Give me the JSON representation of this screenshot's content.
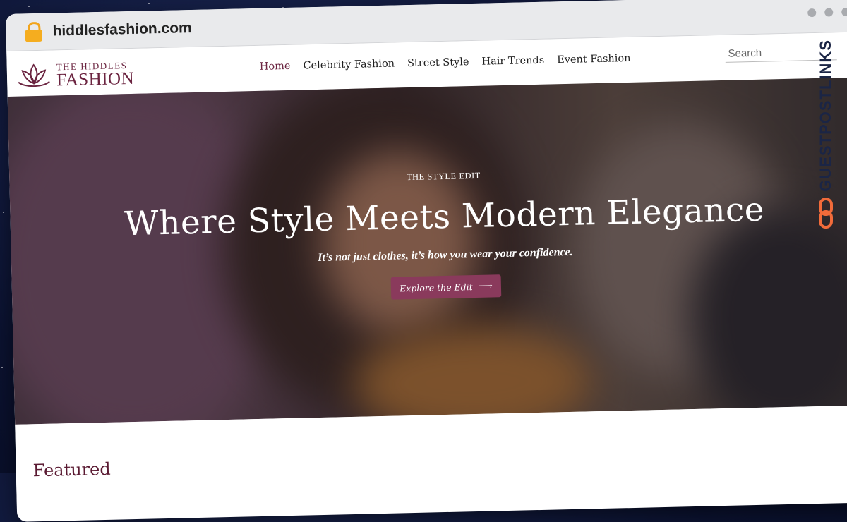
{
  "browser": {
    "url": "hiddlesfashion.com",
    "icons": {
      "lock": "lock-icon",
      "window_dots": "window-control-dots"
    }
  },
  "logo": {
    "top": "THE HIDDLES",
    "bottom": "FASHION",
    "icon": "lotus-icon"
  },
  "nav": {
    "items": [
      {
        "label": "Home",
        "active": true
      },
      {
        "label": "Celebrity Fashion",
        "active": false
      },
      {
        "label": "Street Style",
        "active": false
      },
      {
        "label": "Hair Trends",
        "active": false
      },
      {
        "label": "Event Fashion",
        "active": false
      }
    ]
  },
  "search": {
    "placeholder": "Search"
  },
  "hero": {
    "eyebrow": "THE STYLE EDIT",
    "headline": "Where Style Meets Modern Elegance",
    "subline": "It’s not just clothes, it’s how you wear your confidence.",
    "cta_label": "Explore the Edit",
    "cta_icon": "arrow-right-icon"
  },
  "section": {
    "featured_title": "Featured"
  },
  "watermark": {
    "text": "GUESTPOSTLINKS",
    "icon": "chain-link-icon"
  },
  "colors": {
    "brand": "#6b2440",
    "cta": "#8a3a5c",
    "lock": "#f5ad1f",
    "watermark_text": "#1b2545",
    "watermark_icon": "#f26b3a"
  }
}
